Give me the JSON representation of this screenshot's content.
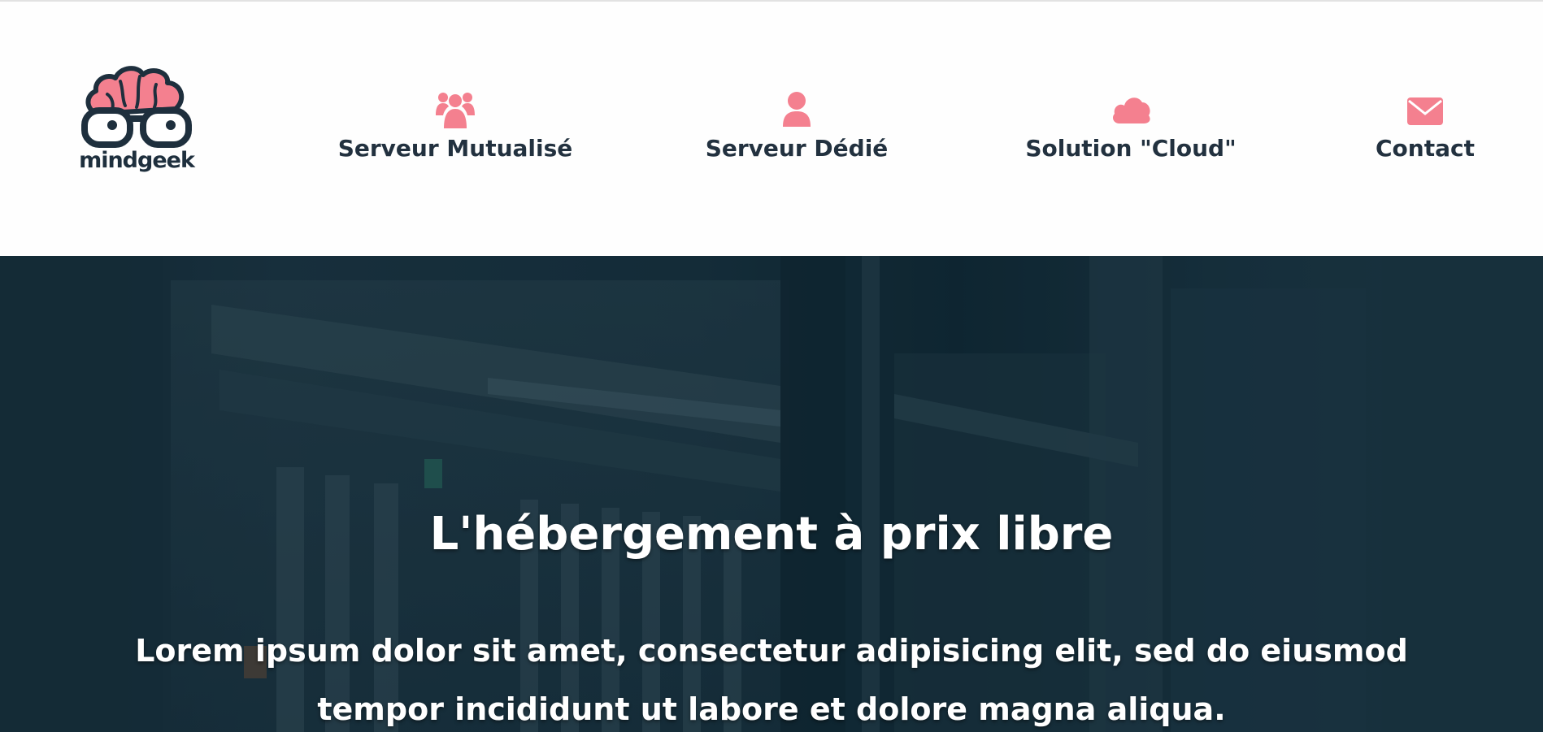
{
  "brand": {
    "name": "mindgeek",
    "logo_icon": "brain-glasses-icon",
    "logo_color": "#f4808f",
    "text_color": "#1e2f3d"
  },
  "nav": {
    "accent_color": "#f4808f",
    "items": [
      {
        "label": "Serveur Mutualisé",
        "icon": "users-icon"
      },
      {
        "label": "Serveur Dédié",
        "icon": "user-icon"
      },
      {
        "label": "Solution \"Cloud\"",
        "icon": "cloud-icon"
      },
      {
        "label": "Contact",
        "icon": "envelope-icon"
      }
    ]
  },
  "hero": {
    "title": "L'hébergement à prix libre",
    "text": "Lorem ipsum dolor sit amet, consectetur adipisicing elit, sed do eiusmod tempor incididunt ut labore et dolore magna aliqua.",
    "background": "server-rack-photo",
    "overlay_color": "#0f2632"
  }
}
